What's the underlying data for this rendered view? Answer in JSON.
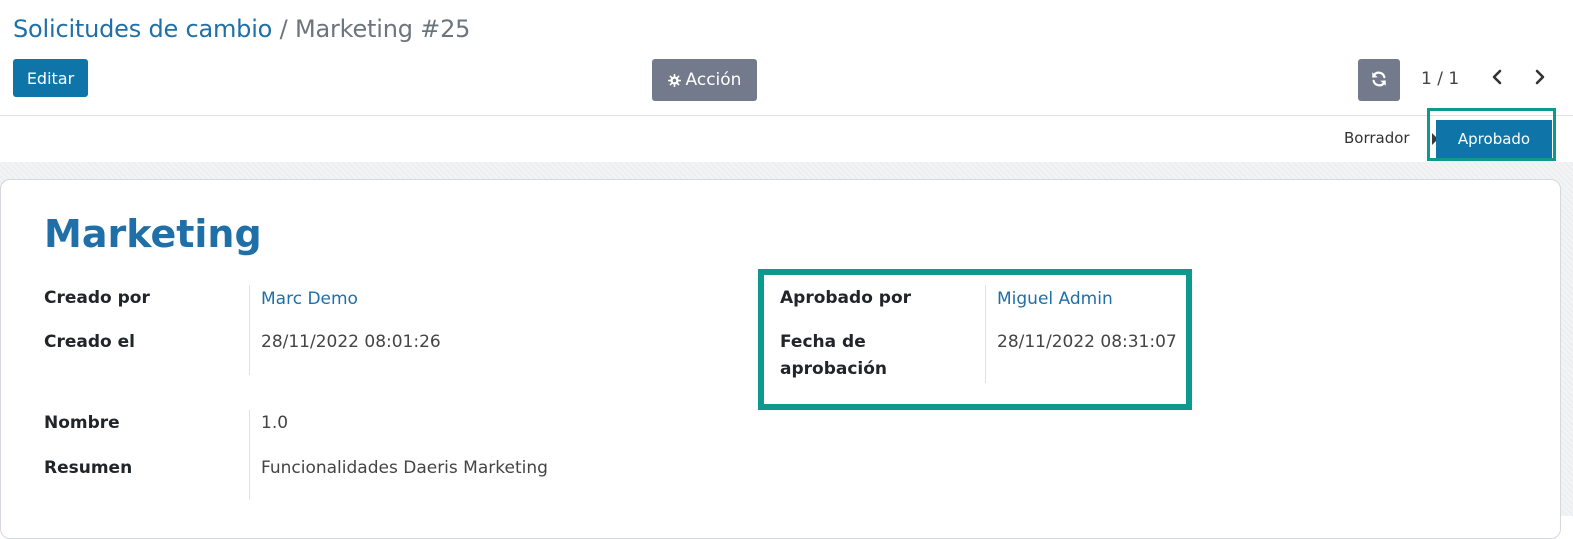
{
  "breadcrumb": {
    "parent": "Solicitudes de cambio",
    "separator": "/",
    "current": "Marketing #25"
  },
  "toolbar": {
    "edit_label": "Editar",
    "action_label": "Acción",
    "action_icon": "gear-icon",
    "refresh_icon": "refresh-icon"
  },
  "pager": {
    "value": "1 / 1",
    "prev_icon": "chevron-left-icon",
    "next_icon": "chevron-right-icon"
  },
  "statusbar": {
    "stages": [
      "Borrador",
      "Aprobado"
    ],
    "active": "Aprobado"
  },
  "record": {
    "title": "Marketing",
    "created_by_label": "Creado por",
    "created_by": "Marc Demo",
    "created_on_label": "Creado el",
    "created_on": "28/11/2022 08:01:26",
    "approved_by_label": "Aprobado por",
    "approved_by": "Miguel Admin",
    "approval_date_label_1": "Fecha de",
    "approval_date_label_2": "aprobación",
    "approval_date": "28/11/2022 08:31:07",
    "name_label": "Nombre",
    "name": "1.0",
    "summary_label": "Resumen",
    "summary": "Funcionalidades Daeris Marketing"
  },
  "colors": {
    "primary": "#0f75a8",
    "link": "#1f6fa8",
    "secondary_button": "#727a8c",
    "highlight": "#0d9a8e"
  }
}
